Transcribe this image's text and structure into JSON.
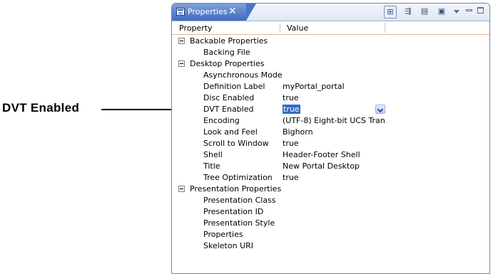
{
  "callout": {
    "label": "DVT Enabled"
  },
  "view": {
    "tab": {
      "label": "Properties",
      "close": "✕"
    },
    "toolbar": [
      {
        "name": "show-categories-button",
        "glyph": "⊞",
        "pressed": true
      },
      {
        "name": "show-advanced-button",
        "glyph": "⇶",
        "pressed": false
      },
      {
        "name": "filter-properties-button",
        "glyph": "▤",
        "pressed": false
      },
      {
        "name": "restore-default-button",
        "glyph": "▣",
        "pressed": false
      }
    ],
    "columns": {
      "property": "Property",
      "value": "Value"
    }
  },
  "categories": [
    {
      "name": "Backable Properties",
      "items": [
        {
          "name": "Backing File",
          "value": ""
        }
      ]
    },
    {
      "name": "Desktop Properties",
      "items": [
        {
          "name": "Asynchronous Mode",
          "value": ""
        },
        {
          "name": "Definition Label",
          "value": "myPortal_portal"
        },
        {
          "name": "Disc Enabled",
          "value": "true"
        },
        {
          "name": "DVT Enabled",
          "value": "true",
          "editing": true
        },
        {
          "name": "Encoding",
          "value": "(UTF-8) Eight-bit UCS Tran..."
        },
        {
          "name": "Look and Feel",
          "value": "Bighorn"
        },
        {
          "name": "Scroll to Window",
          "value": "true"
        },
        {
          "name": "Shell",
          "value": "Header-Footer Shell"
        },
        {
          "name": "Title",
          "value": "New Portal Desktop"
        },
        {
          "name": "Tree Optimization",
          "value": "true"
        }
      ]
    },
    {
      "name": "Presentation Properties",
      "items": [
        {
          "name": "Presentation Class",
          "value": ""
        },
        {
          "name": "Presentation ID",
          "value": ""
        },
        {
          "name": "Presentation Style",
          "value": ""
        },
        {
          "name": "Properties",
          "value": ""
        },
        {
          "name": "Skeleton URI",
          "value": ""
        }
      ]
    }
  ]
}
